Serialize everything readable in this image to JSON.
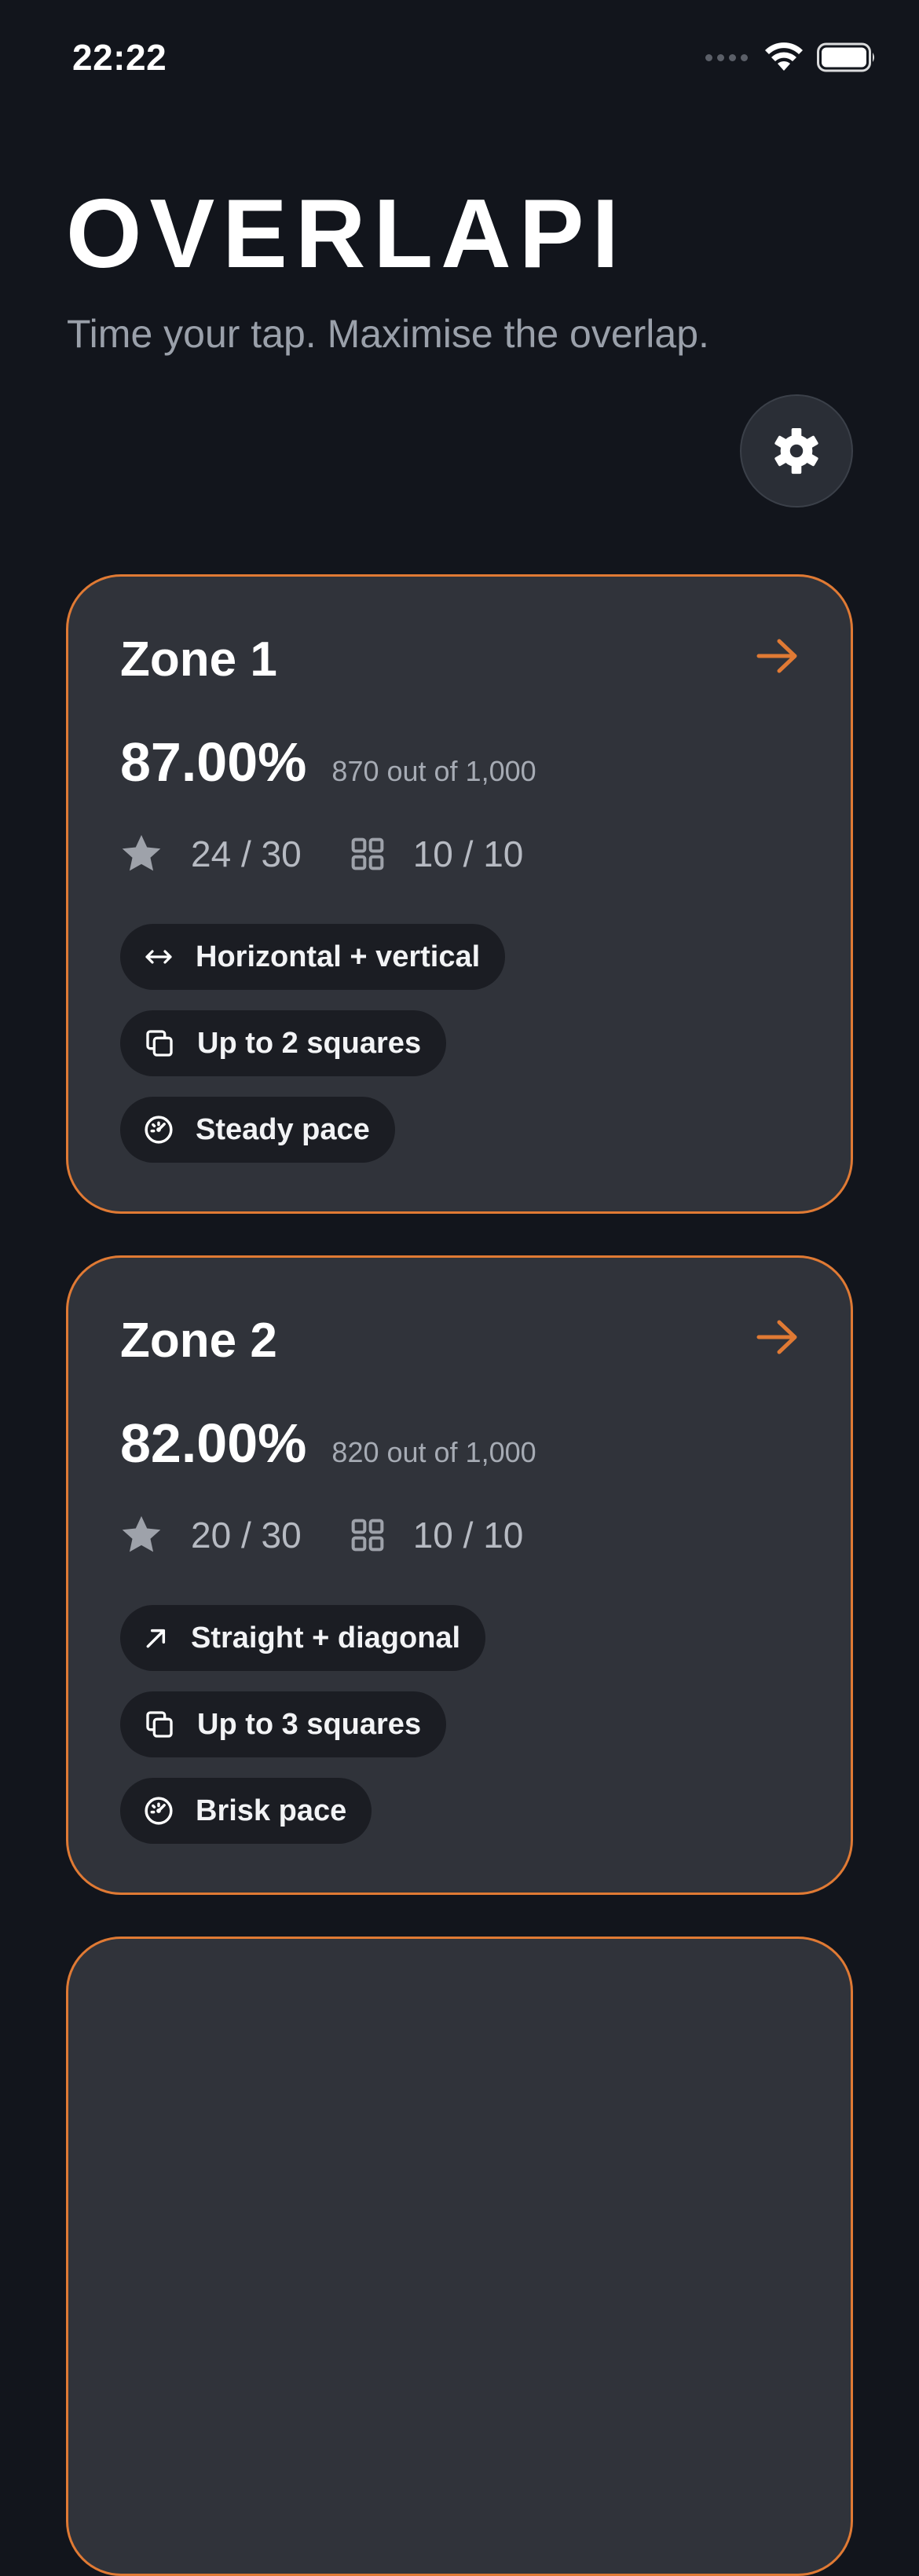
{
  "status_bar": {
    "time": "22:22",
    "icons": [
      "cellular-signal-icon",
      "wifi-icon",
      "battery-icon"
    ]
  },
  "header": {
    "title": "OVERLAPI",
    "tagline": "Time your tap. Maximise the overlap."
  },
  "settings": {
    "icon": "gear-icon"
  },
  "colors": {
    "background": "#12151c",
    "card": "#30333a",
    "accent": "#e07a34",
    "pill": "#1b1d23",
    "muted_text": "#a6abb4"
  },
  "zones": [
    {
      "title": "Zone 1",
      "percent": "87.00%",
      "points": "870 out of 1,000",
      "stars": "24 / 30",
      "levels": "10 / 10",
      "tags": [
        {
          "icon": "horizontal-arrows-icon",
          "label": "Horizontal + vertical"
        },
        {
          "icon": "copy-squares-icon",
          "label": "Up to 2 squares"
        },
        {
          "icon": "speedometer-icon",
          "label": "Steady pace"
        }
      ]
    },
    {
      "title": "Zone 2",
      "percent": "82.00%",
      "points": "820 out of 1,000",
      "stars": "20 / 30",
      "levels": "10 / 10",
      "tags": [
        {
          "icon": "diagonal-arrow-icon",
          "label": "Straight + diagonal"
        },
        {
          "icon": "copy-squares-icon",
          "label": "Up to 3 squares"
        },
        {
          "icon": "speedometer-icon",
          "label": "Brisk pace"
        }
      ]
    }
  ]
}
